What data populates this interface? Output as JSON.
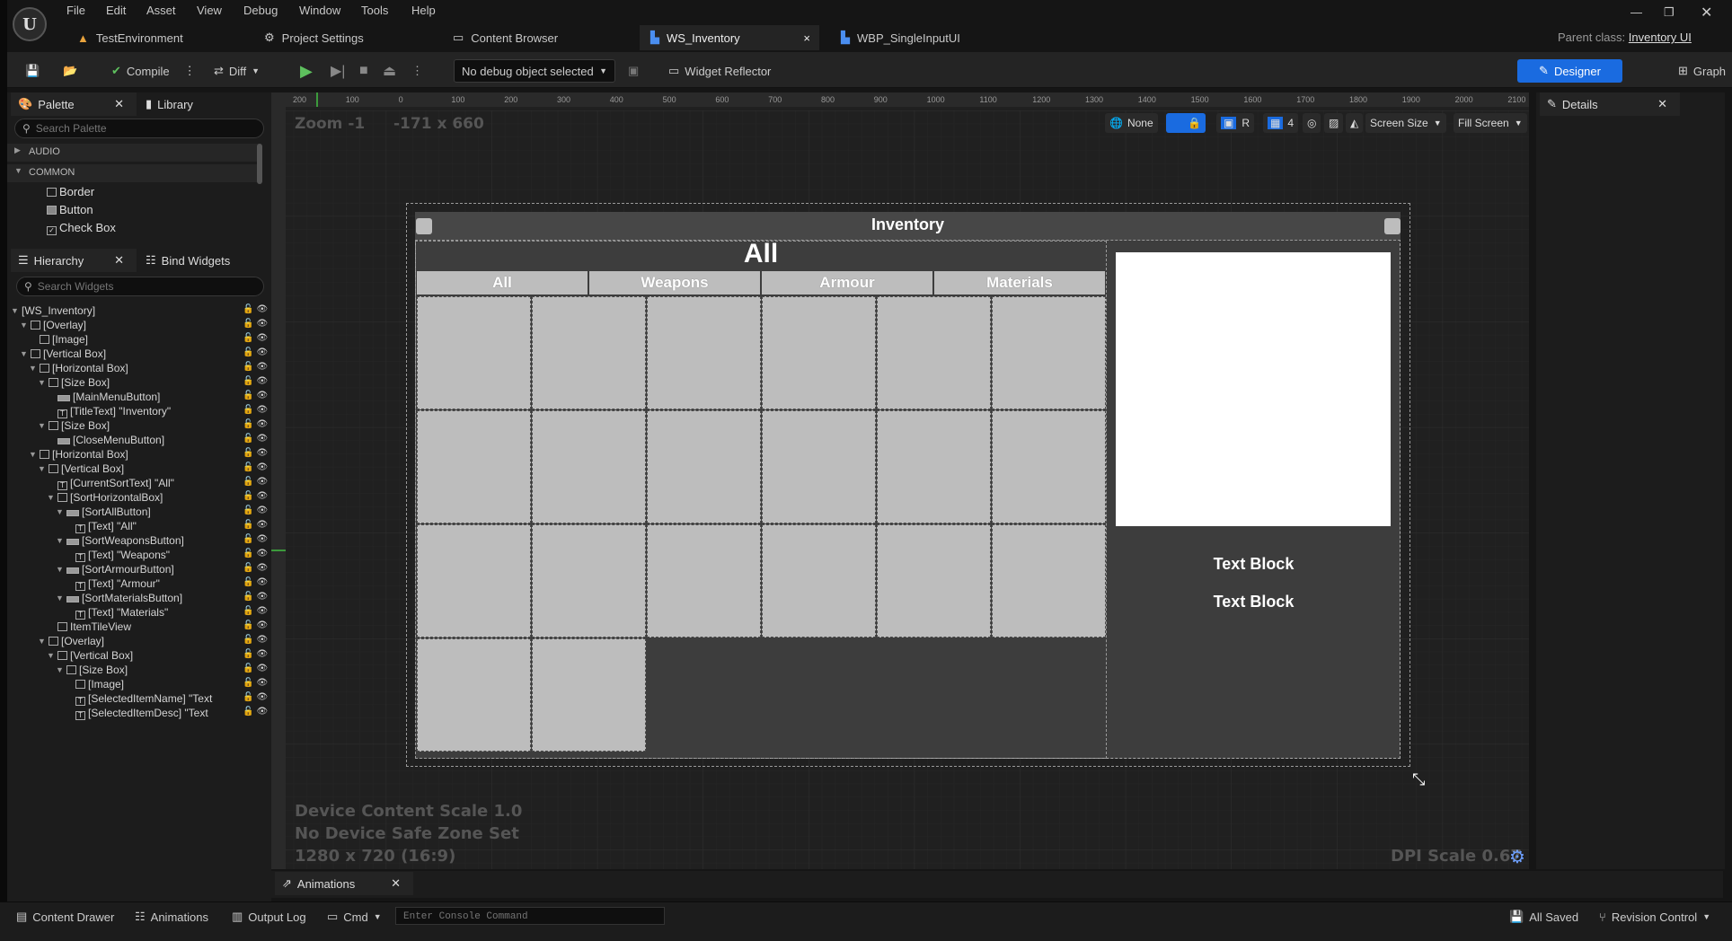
{
  "menu": [
    "File",
    "Edit",
    "Asset",
    "View",
    "Debug",
    "Window",
    "Tools",
    "Help"
  ],
  "tabs": [
    {
      "label": "TestEnvironment"
    },
    {
      "label": "Project Settings"
    },
    {
      "label": "Content Browser"
    },
    {
      "label": "WS_Inventory",
      "close": "×"
    },
    {
      "label": "WBP_SingleInputUI"
    }
  ],
  "parent_class": {
    "label": "Parent class:",
    "value": "Inventory UI"
  },
  "toolbar": {
    "compile": "Compile",
    "diff": "Diff",
    "debug_select": "No debug object selected",
    "widget_reflector": "Widget Reflector",
    "designer": "Designer",
    "graph": "Graph"
  },
  "palette": {
    "tab": "Palette",
    "library": "Library",
    "search_placeholder": "Search Palette",
    "categories": [
      "AUDIO",
      "COMMON"
    ],
    "items": [
      "Border",
      "Button",
      "Check Box"
    ]
  },
  "hierarchy": {
    "tab": "Hierarchy",
    "bind": "Bind Widgets",
    "search_placeholder": "Search Widgets",
    "rows": [
      "[WS_Inventory]",
      "[Overlay]",
      "[Image]",
      "[Vertical Box]",
      "[Horizontal Box]",
      "[Size Box]",
      "[MainMenuButton]",
      "[TitleText] \"Inventory\"",
      "[Size Box]",
      "[CloseMenuButton]",
      "[Horizontal Box]",
      "[Vertical Box]",
      "[CurrentSortText] \"All\"",
      "[SortHorizontalBox]",
      "[SortAllButton]",
      "[Text] \"All\"",
      "[SortWeaponsButton]",
      "[Text] \"Weapons\"",
      "[SortArmourButton]",
      "[Text] \"Armour\"",
      "[SortMaterialsButton]",
      "[Text] \"Materials\"",
      "ItemTileView",
      "[Overlay]",
      "[Vertical Box]",
      "[Size Box]",
      "[Image]",
      "[SelectedItemName] \"Text",
      "[SelectedItemDesc] \"Text"
    ]
  },
  "viewport": {
    "zoom": "Zoom -1",
    "coords": "-171 x 660",
    "none": "None",
    "grid": "4",
    "r": "R",
    "screen_size": "Screen Size",
    "fill_screen": "Fill Screen",
    "device_scale": "Device Content Scale 1.0",
    "safe_zone": "No Device Safe Zone Set",
    "resolution": "1280 x 720 (16:9)",
    "dpi": "DPI Scale 0.67",
    "ruler_h": [
      "200",
      "100",
      "0",
      "100",
      "200",
      "300",
      "400",
      "500",
      "600",
      "700",
      "800",
      "900",
      "1000",
      "1100",
      "1200",
      "1300",
      "1400",
      "1500",
      "1600",
      "1700",
      "1800",
      "1900",
      "2000",
      "2100"
    ]
  },
  "inventory": {
    "title": "Inventory",
    "current_sort": "All",
    "sort_buttons": [
      "All",
      "Weapons",
      "Armour",
      "Materials"
    ],
    "item_name": "Text Block",
    "item_desc": "Text Block"
  },
  "details": {
    "tab": "Details"
  },
  "animations_tab": "Animations",
  "statusbar": {
    "content_drawer": "Content Drawer",
    "animations": "Animations",
    "output_log": "Output Log",
    "cmd": "Cmd",
    "console_placeholder": "Enter Console Command",
    "all_saved": "All Saved",
    "revision_control": "Revision Control"
  }
}
